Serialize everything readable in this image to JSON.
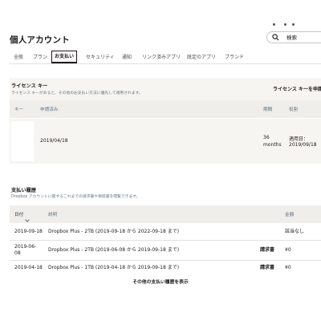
{
  "header": {
    "title": "個人アカウント",
    "search_placeholder": "検索"
  },
  "tabs": [
    {
      "label": "全般",
      "active": false
    },
    {
      "label": "プラン",
      "active": false
    },
    {
      "label": "お支払い",
      "active": true
    },
    {
      "label": "セキュリティ",
      "active": false
    },
    {
      "label": "通知",
      "active": false
    },
    {
      "label": "リンク済みアプリ",
      "active": false
    },
    {
      "label": "既定のアプリ",
      "active": false
    },
    {
      "label": "ブランド",
      "active": false
    }
  ],
  "license": {
    "title": "ライセンス キー",
    "description": "ライセンス キーがあると、その他のお支払い方法に優先して適用されます。",
    "apply_label": "ライセンス キーを申請",
    "columns": {
      "key": "キー",
      "requested": "申請済み",
      "period": "期間",
      "role": "役割"
    },
    "rows": [
      {
        "key": "",
        "requested": "2019/04/18",
        "period_line1": "36",
        "period_line2": "months",
        "role_line1": "適用日：",
        "role_line2": "2019/09/18"
      }
    ]
  },
  "payments": {
    "title": "支払い履歴",
    "description": "Dropbox アカウントに関するこれまでの請求書や領収書を閲覧できます。",
    "columns": {
      "date": "日付",
      "description": "説明",
      "amount": "金額"
    },
    "rows": [
      {
        "date_line1": "2019-09-18",
        "date_line2": "",
        "description": "Dropbox Plus - 2TB (2019-09-18 から 2022-09-18 まで)",
        "invoice": "",
        "amount": "該当なし"
      },
      {
        "date_line1": "2019-06-",
        "date_line2": "08",
        "description": "Dropbox Plus - 2TB (2019-06-08 から 2019-09-18 まで)",
        "invoice": "請求書",
        "amount": "¥0"
      },
      {
        "date_line1": "2019-04-18",
        "date_line2": "",
        "description": "Dropbox Plus - 1TB (2019-04-18 から 2019-09-18 まで)",
        "invoice": "請求書",
        "amount": "¥0"
      }
    ],
    "more_label": "その他の支払い履歴を表示"
  }
}
